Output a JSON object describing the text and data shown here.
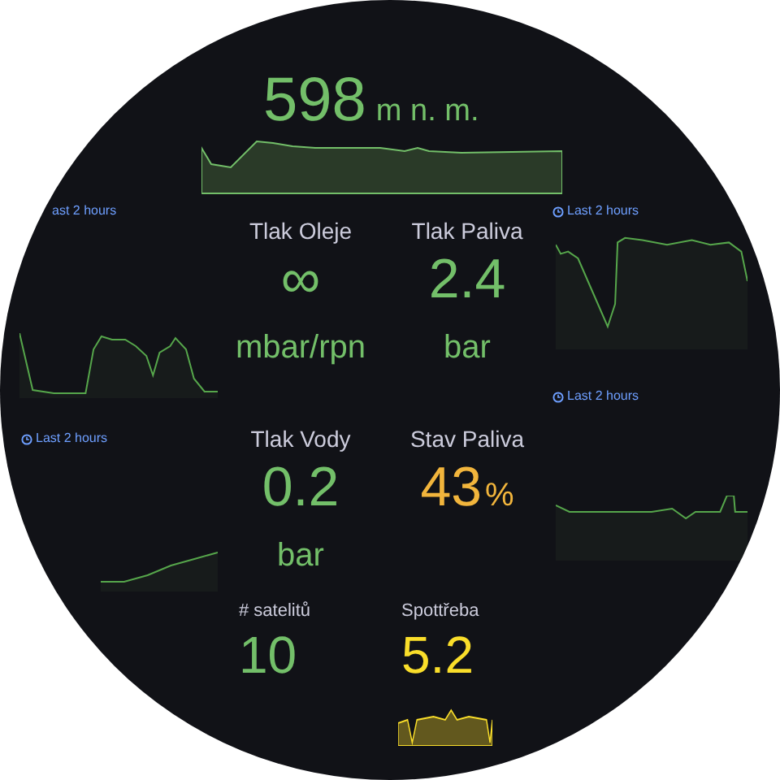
{
  "altitude": {
    "value": "598",
    "unit": "m n. m."
  },
  "graph_panels": [
    {
      "time_range": "ast 2 hours",
      "icon": false
    },
    {
      "time_range": "Last 2 hours",
      "icon": true
    },
    {
      "time_range": "Last 2 hours",
      "icon": true
    },
    {
      "time_range": "Last 2 hours",
      "icon": true
    }
  ],
  "stats": [
    {
      "kind": "unit-below",
      "title": "Tlak Oleje",
      "value": "∞",
      "unit": "mbar/rpn",
      "color": "#73bf69"
    },
    {
      "kind": "unit-below",
      "title": "Tlak Paliva",
      "value": "2.4",
      "unit": "bar",
      "color": "#73bf69"
    },
    {
      "kind": "unit-below",
      "title": "Tlak Vody",
      "value": "0.2",
      "unit": "bar",
      "color": "#73bf69"
    },
    {
      "kind": "unit-inline",
      "title": "Stav Paliva",
      "value": "43",
      "unit": "%",
      "color": "#f2b53c"
    },
    {
      "kind": "small",
      "title": "# satelitů",
      "value": "10",
      "color": "#73bf69"
    },
    {
      "kind": "small",
      "title": "Spottřeba",
      "value": "5.2",
      "color": "#fade2a",
      "sparkline": true
    }
  ]
}
